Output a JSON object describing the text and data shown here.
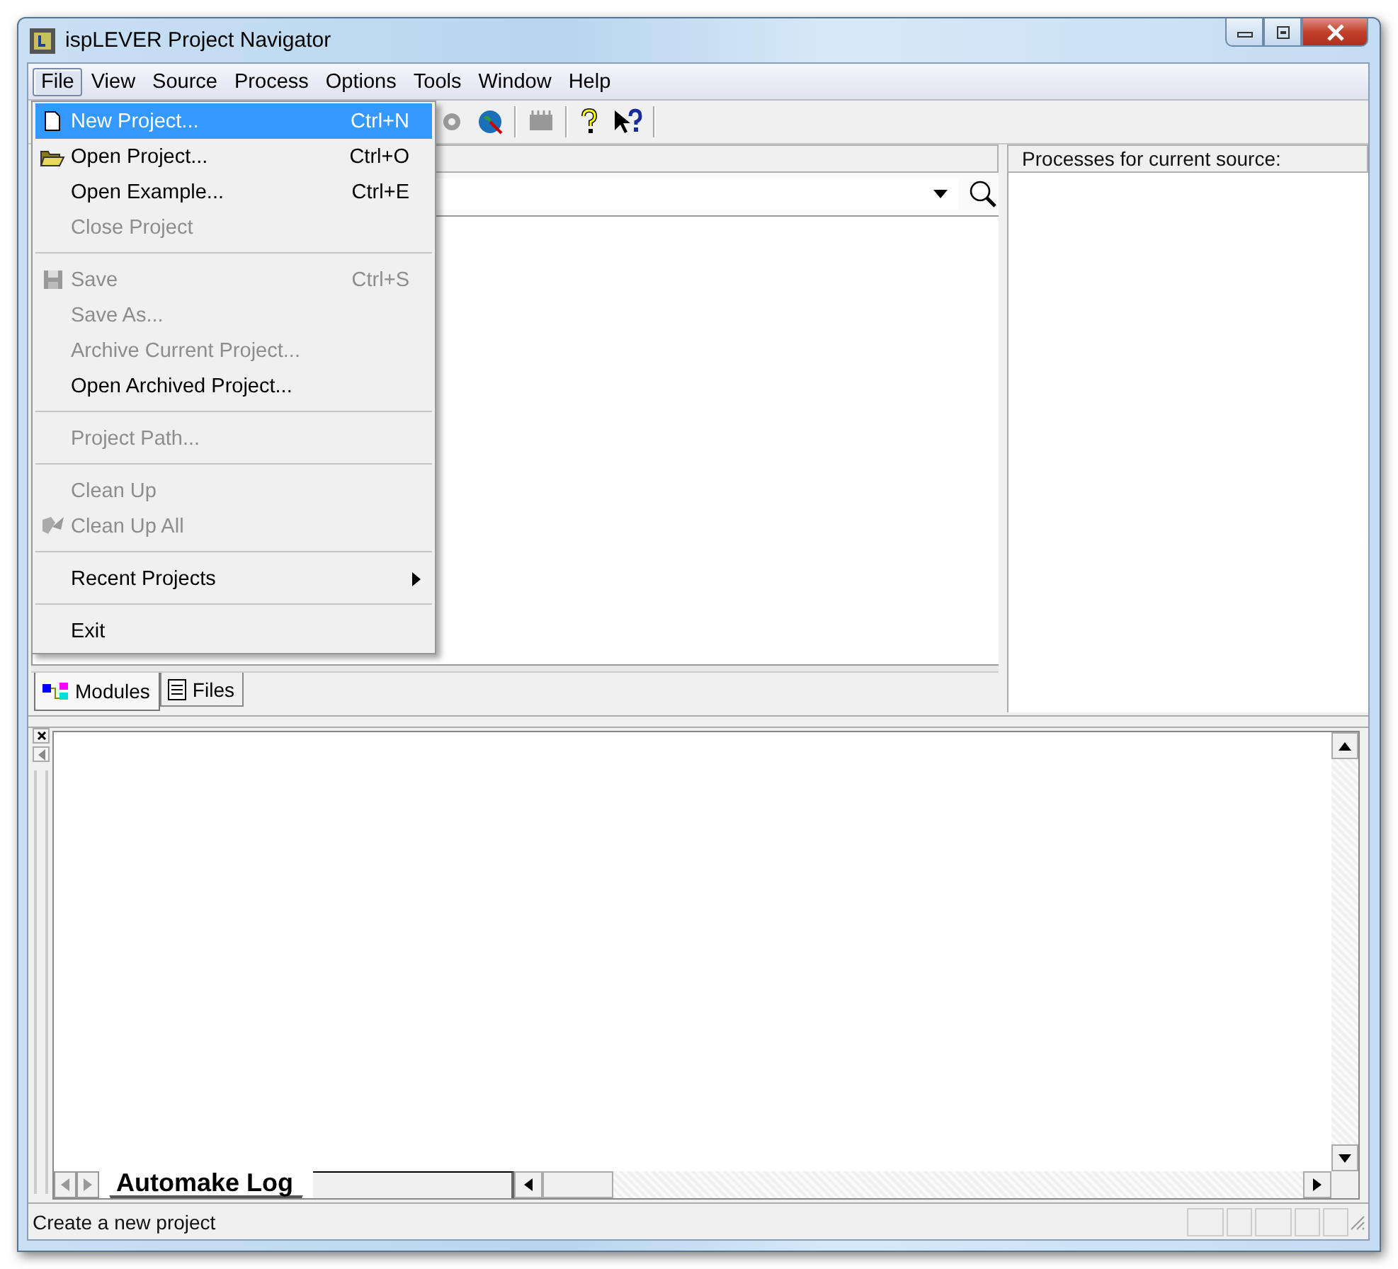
{
  "window": {
    "title": "ispLEVER Project Navigator"
  },
  "menu_bar": [
    {
      "label": "File",
      "selected": true
    },
    {
      "label": "View",
      "selected": false
    },
    {
      "label": "Source",
      "selected": false
    },
    {
      "label": "Process",
      "selected": false
    },
    {
      "label": "Options",
      "selected": false
    },
    {
      "label": "Tools",
      "selected": false
    },
    {
      "label": "Window",
      "selected": false
    },
    {
      "label": "Help",
      "selected": false
    }
  ],
  "file_menu": [
    {
      "kind": "item",
      "label": "New Project...",
      "shortcut": "Ctrl+N",
      "disabled": false,
      "selected": true
    },
    {
      "kind": "item",
      "label": "Open Project...",
      "shortcut": "Ctrl+O",
      "disabled": false,
      "selected": false
    },
    {
      "kind": "item",
      "label": "Open Example...",
      "shortcut": "Ctrl+E",
      "disabled": false,
      "selected": false
    },
    {
      "kind": "item",
      "label": "Close Project",
      "disabled": true,
      "selected": false
    },
    {
      "kind": "separator"
    },
    {
      "kind": "item",
      "label": "Save",
      "shortcut": "Ctrl+S",
      "disabled": true,
      "selected": false
    },
    {
      "kind": "item",
      "label": "Save As...",
      "disabled": true,
      "selected": false
    },
    {
      "kind": "item",
      "label": "Archive Current Project...",
      "disabled": true,
      "selected": false
    },
    {
      "kind": "item",
      "label": "Open Archived Project...",
      "disabled": false,
      "selected": false
    },
    {
      "kind": "separator"
    },
    {
      "kind": "item",
      "label": "Project Path...",
      "disabled": true,
      "selected": false
    },
    {
      "kind": "separator"
    },
    {
      "kind": "item",
      "label": "Clean Up",
      "disabled": true,
      "selected": false
    },
    {
      "kind": "item",
      "label": "Clean Up All",
      "disabled": true,
      "selected": false
    },
    {
      "kind": "separator"
    },
    {
      "kind": "submenu",
      "label": "Recent Projects",
      "disabled": false,
      "selected": false
    },
    {
      "kind": "separator"
    },
    {
      "kind": "item",
      "label": "Exit",
      "disabled": false,
      "selected": false
    }
  ],
  "project_tabs": [
    {
      "label": "Modules",
      "selected": true
    },
    {
      "label": "Files",
      "selected": false
    }
  ],
  "processes_pane": {
    "title": "Processes for current source:"
  },
  "log_tabs": [
    {
      "label": "Automake Log",
      "selected": true
    }
  ],
  "status_bar": {
    "text": "Create a new project"
  }
}
